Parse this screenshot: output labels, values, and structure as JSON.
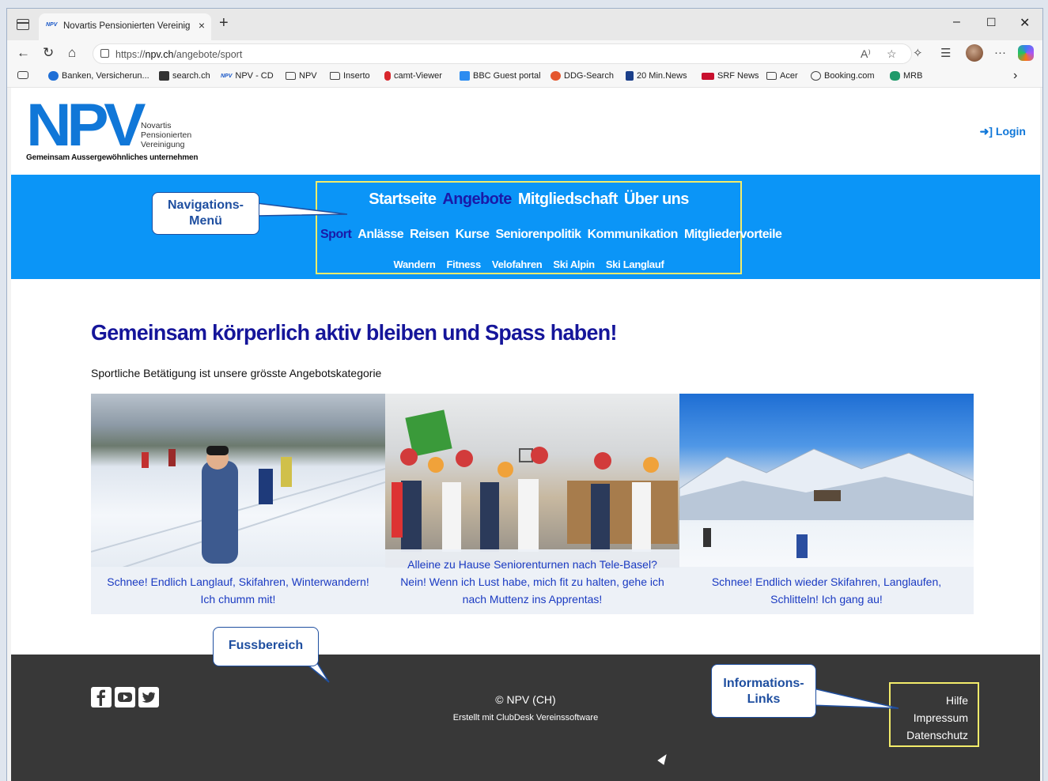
{
  "browser": {
    "tab_favicon": "NPV",
    "tab_title": "Novartis Pensionierten Vereinigun",
    "tab_close": "×",
    "new_tab": "+",
    "url_prefix": "https://",
    "url_domain": "npv.ch",
    "url_path": "/angebote/sport",
    "window_controls": {
      "minimize": "–",
      "maximize": "☐",
      "close": "✕"
    },
    "nav": {
      "back": "←",
      "reload": "↻",
      "home": "⌂"
    },
    "toolbar_icons": [
      "read-aloud-icon",
      "favorite-star-icon",
      "extensions-icon",
      "favorites-icon",
      "profile-avatar",
      "more-icon",
      "copilot-icon"
    ],
    "more_label": "···",
    "bookmarks": [
      {
        "label": "Banken, Versicherun...",
        "icon_color": "#1f6fd6"
      },
      {
        "label": "search.ch",
        "icon_color": "#333333"
      },
      {
        "label": "NPV - CD",
        "icon_color": "#1a58c8"
      },
      {
        "label": "NPV",
        "icon_color": "folder"
      },
      {
        "label": "Inserto",
        "icon_color": "folder"
      },
      {
        "label": "camt-Viewer",
        "icon_color": "#d8262c"
      },
      {
        "label": "BBC Guest portal",
        "icon_color": "#2d8cf0"
      },
      {
        "label": "DDG-Search",
        "icon_color": "#e4572e"
      },
      {
        "label": "20 Min.News",
        "icon_color": "#1b3f8a"
      },
      {
        "label": "SRF News",
        "icon_color": "#c8102e"
      },
      {
        "label": "Acer",
        "icon_color": "folder"
      },
      {
        "label": "Booking.com",
        "icon_color": "globe"
      },
      {
        "label": "MRB",
        "icon_color": "#1f9a6a"
      }
    ],
    "bookmarks_more": "›"
  },
  "site": {
    "logo_text": "NPV",
    "logo_sub": [
      "Novartis",
      "Pensionierten",
      "Vereinigung"
    ],
    "logo_tagline": "Gemeinsam Aussergewöhnliches unternehmen",
    "login_label": "Login",
    "nav_main": [
      "Startseite",
      "Angebote",
      "Mitgliedschaft",
      "Über uns"
    ],
    "nav_main_active": "Angebote",
    "nav_sub": [
      "Sport",
      "Anlässe",
      "Reisen",
      "Kurse",
      "Seniorenpolitik",
      "Kommunikation",
      "Mitgliedervorteile"
    ],
    "nav_sub_active": "Sport",
    "nav_sub2": [
      "Wandern",
      "Fitness",
      "Velofahren",
      "Ski Alpin",
      "Ski Langlauf"
    ],
    "heading": "Gemeinsam körperlich aktiv bleiben und Spass haben!",
    "lead": "Sportliche Betätigung ist unsere grösste Angebotskategorie",
    "cards": [
      {
        "caption": "Schnee! Endlich Langlauf, Skifahren, Winterwandern! Ich chumm mit!"
      },
      {
        "caption": "Alleine zu Hause Seniorenturnen nach Tele-Basel? Nein! Wenn ich Lust habe, mich fit zu halten, gehe ich nach Muttenz ins Apprentas!"
      },
      {
        "caption": "Schnee! Endlich wieder Skifahren, Langlaufen, Schlitteln! Ich gang au!"
      }
    ],
    "footer": {
      "social": [
        "facebook-icon",
        "youtube-icon",
        "twitter-icon"
      ],
      "copyright": "© NPV (CH)",
      "created_with": "Erstellt mit ClubDesk Vereinssoftware",
      "info_links": [
        "Hilfe",
        "Impressum",
        "Datenschutz"
      ]
    }
  },
  "annotations": {
    "nav_callout": [
      "Navigations-",
      "Menü"
    ],
    "footer_callout": "Fussbereich",
    "info_callout": [
      "Informations-",
      "Links"
    ],
    "callout_color": "#1f4fa0",
    "highlight_color": "#f3ec6a"
  },
  "colors": {
    "brand_blue": "#1077d8",
    "nav_band": "#0b95f7",
    "active_nav": "#1a1aa8",
    "heading": "#15159a",
    "caption_text": "#1a3ac2",
    "footer_bg": "#383838"
  }
}
